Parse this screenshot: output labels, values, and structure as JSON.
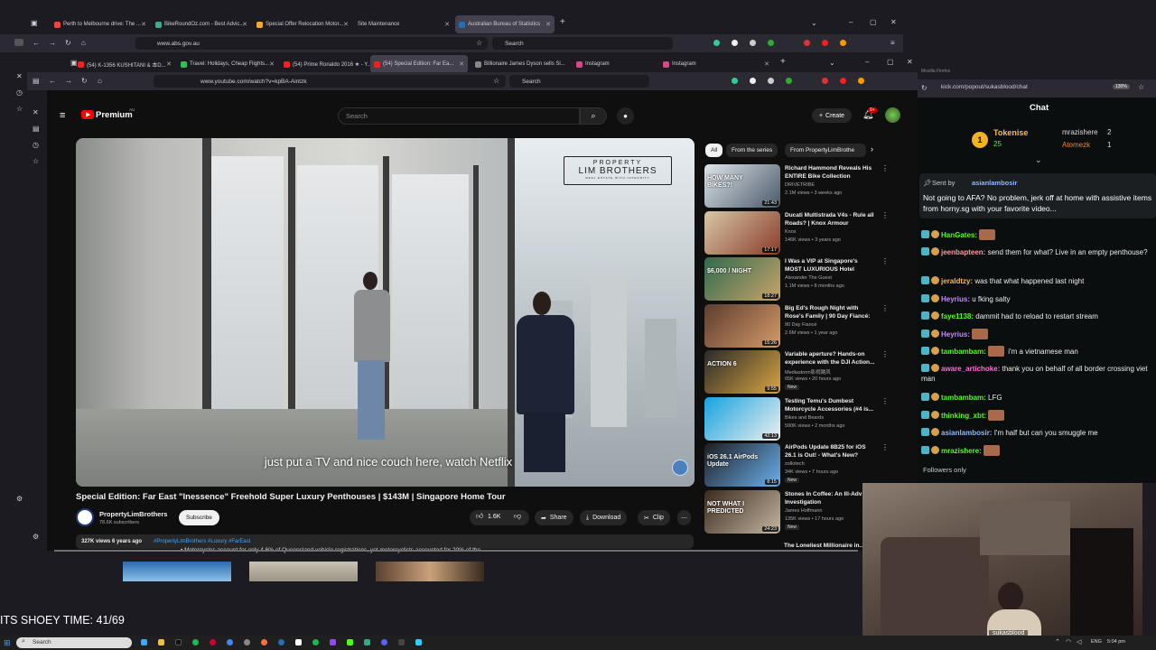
{
  "back_browser": {
    "tabs": [
      "Perth to Melbourne drive: The ...",
      "BikeRoundOz.com - Best Advic...",
      "Special Offer Relocation Motor...",
      "Site Maintenance",
      "Australian Bureau of Statistics"
    ],
    "url": "www.abs.gov.au",
    "search_placeholder": "Search"
  },
  "front_browser": {
    "tabs": [
      "(54) K-1356 KUSHITANI & 本D...",
      "Travel: Holidays, Cheap Flights...",
      "(54) Prime Ronaldo 2016 ★ - Y...",
      "(54) Special Edition: Far Ea...",
      "Billionaire James Dyson sells Si...",
      "Instagram",
      "Instagram"
    ],
    "url": "www.youtube.com/watch?v=kpBA-Aintzk",
    "search_placeholder": "Search"
  },
  "youtube": {
    "logo": "Premium",
    "logo_sup": "AU",
    "search_placeholder": "Search",
    "create": "Create",
    "notif_count": "9+",
    "caption": "just put a TV and nice couch here, watch Netflix",
    "watermark_line1": "PROPERTY",
    "watermark_line2": "LIM BROTHERS",
    "watermark_line3": "REAL ESTATE WITH INTEGRITY",
    "title": "Special Edition: Far East \"Inessence\" Freehold Super Luxury Penthouses | $143M | Singapore Home Tour",
    "channel": "PropertyLimBrothers",
    "subscribers": "78.6K subscribers",
    "subscribe": "Subscribe",
    "likes": "1.6K",
    "share": "Share",
    "download": "Download",
    "clip": "Clip",
    "desc_meta": "327K views  6 years ago",
    "desc_tags": "#PropertyLimBrothers #Luxury #FarEast",
    "overlay_text": "• Motorcycles account for only 4.6% of Queensland vehicle registrations, yet motorcyclists accounted for 20% of the",
    "chips": [
      "All",
      "From the series",
      "From PropertyLimBrothe"
    ],
    "recs": [
      {
        "title": "Richard Hammond Reveals His ENTIRE Bike Collection",
        "channel": "DRIVETRIBE",
        "meta": "2.1M views • 3 weeks ago",
        "dur": "21:43",
        "thumb_text": "HOW MANY BIKES?!",
        "new": ""
      },
      {
        "title": "Ducati Multistrada V4s - Rule all Roads? | Knox Armour",
        "channel": "Knox",
        "meta": "146K views • 3 years ago",
        "dur": "17:17",
        "thumb_text": "",
        "new": ""
      },
      {
        "title": "I Was a VIP at Singapore's MOST LUXURIOUS Hotel",
        "channel": "Alexander The Guest",
        "meta": "1.1M views • 8 months ago",
        "dur": "18:27",
        "thumb_text": "$6,000 / NIGHT",
        "new": ""
      },
      {
        "title": "Big Ed's Rough Night with Rose's Family | 90 Day Fiancé: ...",
        "channel": "90 Day Fiancé",
        "meta": "2.6M views • 1 year ago",
        "dur": "15:26",
        "thumb_text": "",
        "new": ""
      },
      {
        "title": "Variable aperture? Hands-on experience with the DJI Action...",
        "channel": "Mediastorm影视飓风",
        "meta": "65K views • 20 hours ago",
        "dur": "9:55",
        "thumb_text": "ACTION 6",
        "new": "New"
      },
      {
        "title": "Testing Temu's Dumbest Motorcycle Accessories (#4 is...",
        "channel": "Bikes and Beards",
        "meta": "590K views • 2 months ago",
        "dur": "42:13",
        "thumb_text": "",
        "new": ""
      },
      {
        "title": "AirPods Update 8B25 for iOS 26.1 is Out! - What's New?",
        "channel": "zollotech",
        "meta": "34K views • 7 hours ago",
        "dur": "8:15",
        "thumb_text": "iOS 26.1 AirPods Update",
        "new": "New"
      },
      {
        "title": "Stones In Coffee: An Ill-Adv Investigation",
        "channel": "James Hoffmann",
        "meta": "135K views • 17 hours ago",
        "dur": "24:23",
        "thumb_text": "NOT WHAT I PREDICTED",
        "new": "New"
      }
    ],
    "partial_next": "The Loneliest Millionaire in..."
  },
  "kick": {
    "url": "kick.com/popout/sukasblood/chat",
    "zoom": "130%",
    "title": "Chat",
    "top": [
      {
        "name": "Tokenise",
        "count": "25"
      },
      {
        "name": "mrazishere",
        "count": "2"
      },
      {
        "name": "Atomezk",
        "count": "1"
      }
    ],
    "pinned_by": "Sent by",
    "pinned_user": "asianlambosir",
    "pinned_text": "Not going to AFA? No problem, jerk off at home with assistive items from horny.sg with your favorite video...",
    "messages": [
      {
        "user": "HanGates:",
        "text": "",
        "emote": true
      },
      {
        "user": "jeenbapteen:",
        "text": "send them for what? Live in an empty penthouse?",
        "emote": false
      },
      {
        "user": "jeraldtzy:",
        "text": "was that what happened last night",
        "emote": false
      },
      {
        "user": "Heyrius:",
        "text": "u fking salty",
        "emote": false
      },
      {
        "user": "faye1138:",
        "text": "dammit had to reload to restart stream",
        "emote": false
      },
      {
        "user": "Heyrius:",
        "text": "",
        "emote": true
      },
      {
        "user": "tambambam:",
        "text": "i'm a vietnamese man",
        "emote": true
      },
      {
        "user": "aware_artichoke:",
        "text": "thank you on behalf of all border crossing viet man",
        "emote": false
      },
      {
        "user": "tambambam:",
        "text": "LFG",
        "emote": false
      },
      {
        "user": "thinking_xbt:",
        "text": "",
        "emote": true
      },
      {
        "user": "asianlambosir:",
        "text": "I'm half but can you smuggle me",
        "emote": false
      },
      {
        "user": "mrazishere:",
        "text": "",
        "emote": true
      }
    ],
    "followers_only": "Followers only",
    "cam_label": "sukasblood"
  },
  "counter": "ITS SHOEY TIME: 41/69",
  "taskbar": {
    "search": "Search",
    "lang": "ENG",
    "time": "5:04 pm"
  },
  "side_browser_title": "Mozilla Firefox"
}
